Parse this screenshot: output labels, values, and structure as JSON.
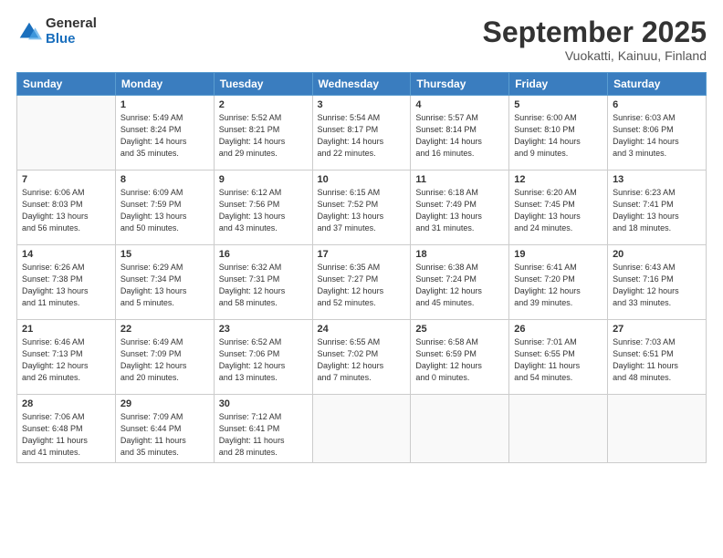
{
  "header": {
    "logo_general": "General",
    "logo_blue": "Blue",
    "title": "September 2025",
    "subtitle": "Vuokatti, Kainuu, Finland"
  },
  "days_of_week": [
    "Sunday",
    "Monday",
    "Tuesday",
    "Wednesday",
    "Thursday",
    "Friday",
    "Saturday"
  ],
  "weeks": [
    [
      {
        "day": "",
        "info": ""
      },
      {
        "day": "1",
        "info": "Sunrise: 5:49 AM\nSunset: 8:24 PM\nDaylight: 14 hours\nand 35 minutes."
      },
      {
        "day": "2",
        "info": "Sunrise: 5:52 AM\nSunset: 8:21 PM\nDaylight: 14 hours\nand 29 minutes."
      },
      {
        "day": "3",
        "info": "Sunrise: 5:54 AM\nSunset: 8:17 PM\nDaylight: 14 hours\nand 22 minutes."
      },
      {
        "day": "4",
        "info": "Sunrise: 5:57 AM\nSunset: 8:14 PM\nDaylight: 14 hours\nand 16 minutes."
      },
      {
        "day": "5",
        "info": "Sunrise: 6:00 AM\nSunset: 8:10 PM\nDaylight: 14 hours\nand 9 minutes."
      },
      {
        "day": "6",
        "info": "Sunrise: 6:03 AM\nSunset: 8:06 PM\nDaylight: 14 hours\nand 3 minutes."
      }
    ],
    [
      {
        "day": "7",
        "info": "Sunrise: 6:06 AM\nSunset: 8:03 PM\nDaylight: 13 hours\nand 56 minutes."
      },
      {
        "day": "8",
        "info": "Sunrise: 6:09 AM\nSunset: 7:59 PM\nDaylight: 13 hours\nand 50 minutes."
      },
      {
        "day": "9",
        "info": "Sunrise: 6:12 AM\nSunset: 7:56 PM\nDaylight: 13 hours\nand 43 minutes."
      },
      {
        "day": "10",
        "info": "Sunrise: 6:15 AM\nSunset: 7:52 PM\nDaylight: 13 hours\nand 37 minutes."
      },
      {
        "day": "11",
        "info": "Sunrise: 6:18 AM\nSunset: 7:49 PM\nDaylight: 13 hours\nand 31 minutes."
      },
      {
        "day": "12",
        "info": "Sunrise: 6:20 AM\nSunset: 7:45 PM\nDaylight: 13 hours\nand 24 minutes."
      },
      {
        "day": "13",
        "info": "Sunrise: 6:23 AM\nSunset: 7:41 PM\nDaylight: 13 hours\nand 18 minutes."
      }
    ],
    [
      {
        "day": "14",
        "info": "Sunrise: 6:26 AM\nSunset: 7:38 PM\nDaylight: 13 hours\nand 11 minutes."
      },
      {
        "day": "15",
        "info": "Sunrise: 6:29 AM\nSunset: 7:34 PM\nDaylight: 13 hours\nand 5 minutes."
      },
      {
        "day": "16",
        "info": "Sunrise: 6:32 AM\nSunset: 7:31 PM\nDaylight: 12 hours\nand 58 minutes."
      },
      {
        "day": "17",
        "info": "Sunrise: 6:35 AM\nSunset: 7:27 PM\nDaylight: 12 hours\nand 52 minutes."
      },
      {
        "day": "18",
        "info": "Sunrise: 6:38 AM\nSunset: 7:24 PM\nDaylight: 12 hours\nand 45 minutes."
      },
      {
        "day": "19",
        "info": "Sunrise: 6:41 AM\nSunset: 7:20 PM\nDaylight: 12 hours\nand 39 minutes."
      },
      {
        "day": "20",
        "info": "Sunrise: 6:43 AM\nSunset: 7:16 PM\nDaylight: 12 hours\nand 33 minutes."
      }
    ],
    [
      {
        "day": "21",
        "info": "Sunrise: 6:46 AM\nSunset: 7:13 PM\nDaylight: 12 hours\nand 26 minutes."
      },
      {
        "day": "22",
        "info": "Sunrise: 6:49 AM\nSunset: 7:09 PM\nDaylight: 12 hours\nand 20 minutes."
      },
      {
        "day": "23",
        "info": "Sunrise: 6:52 AM\nSunset: 7:06 PM\nDaylight: 12 hours\nand 13 minutes."
      },
      {
        "day": "24",
        "info": "Sunrise: 6:55 AM\nSunset: 7:02 PM\nDaylight: 12 hours\nand 7 minutes."
      },
      {
        "day": "25",
        "info": "Sunrise: 6:58 AM\nSunset: 6:59 PM\nDaylight: 12 hours\nand 0 minutes."
      },
      {
        "day": "26",
        "info": "Sunrise: 7:01 AM\nSunset: 6:55 PM\nDaylight: 11 hours\nand 54 minutes."
      },
      {
        "day": "27",
        "info": "Sunrise: 7:03 AM\nSunset: 6:51 PM\nDaylight: 11 hours\nand 48 minutes."
      }
    ],
    [
      {
        "day": "28",
        "info": "Sunrise: 7:06 AM\nSunset: 6:48 PM\nDaylight: 11 hours\nand 41 minutes."
      },
      {
        "day": "29",
        "info": "Sunrise: 7:09 AM\nSunset: 6:44 PM\nDaylight: 11 hours\nand 35 minutes."
      },
      {
        "day": "30",
        "info": "Sunrise: 7:12 AM\nSunset: 6:41 PM\nDaylight: 11 hours\nand 28 minutes."
      },
      {
        "day": "",
        "info": ""
      },
      {
        "day": "",
        "info": ""
      },
      {
        "day": "",
        "info": ""
      },
      {
        "day": "",
        "info": ""
      }
    ]
  ]
}
